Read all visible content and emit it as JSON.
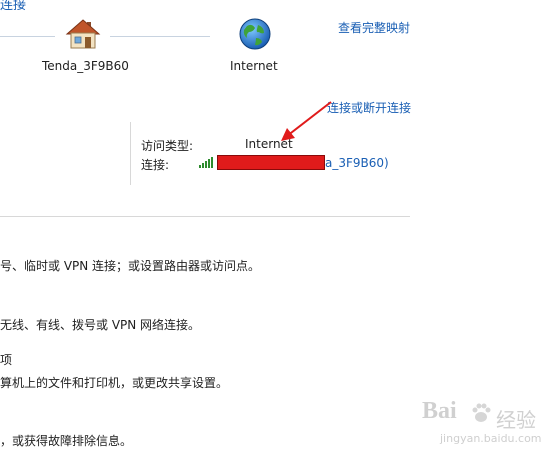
{
  "header": {
    "title_fragment": "连接",
    "view_full_map": "查看完整映射"
  },
  "network_map": {
    "router_label": "Tenda_3F9B60",
    "internet_label": "Internet"
  },
  "active_network": {
    "connect_disconnect": "连接或断开连接",
    "access_type_label": "访问类型:",
    "access_type_value": "Internet",
    "connection_label": "连接:",
    "connection_suffix": "a_3F9B60)"
  },
  "tasks": [
    {
      "text": "号、临时或 VPN 连接；或设置路由器或访问点。"
    },
    {
      "text": "无线、有线、拨号或 VPN 网络连接。"
    },
    {
      "link": "项"
    },
    {
      "text": "算机上的文件和打印机，或更改共享设置。"
    },
    {
      "text": "，或获得故障排除信息。"
    }
  ],
  "watermark": {
    "logo": "Bai",
    "logo_suffix": "经验",
    "url": "jingyan.baidu.com"
  },
  "colors": {
    "link": "#1a5fb4",
    "annotation_arrow": "#e01b1b",
    "signal": "#2e8b2e"
  },
  "icons": [
    "house-icon",
    "globe-icon",
    "signal-strength-icon",
    "baidu-paw-icon"
  ]
}
